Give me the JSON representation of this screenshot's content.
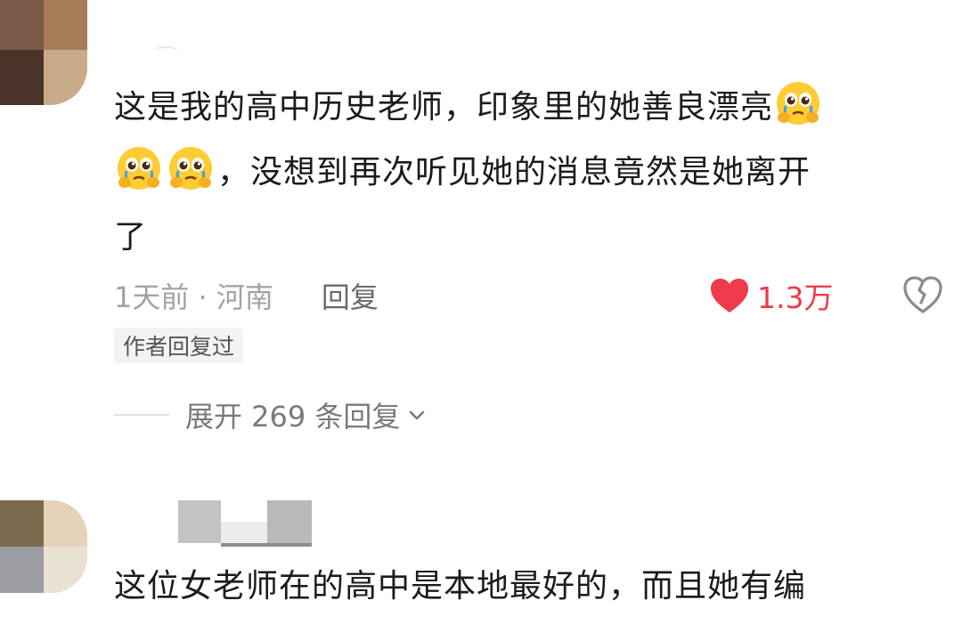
{
  "comment_1": {
    "line_1": "这是我的高中历史老师，印象里的她善良漂亮",
    "line_2": "，没想到再次听见她的消息竟然是她离开",
    "line_3": "了",
    "emoji": "crying-pleading-face-icon",
    "meta_time_location": "1天前 · 河南",
    "reply_label": "回复",
    "like_count": "1.3万",
    "author_badge": "作者回复过",
    "expand_label": "展开 269 条回复"
  },
  "comment_2": {
    "line_1": "这位女老师在的高中是本地最好的，而且她有编"
  },
  "colors": {
    "like_red": "#ee3a4b",
    "meta_gray": "#a3a3a3",
    "text_dark": "#1b1b1b"
  }
}
